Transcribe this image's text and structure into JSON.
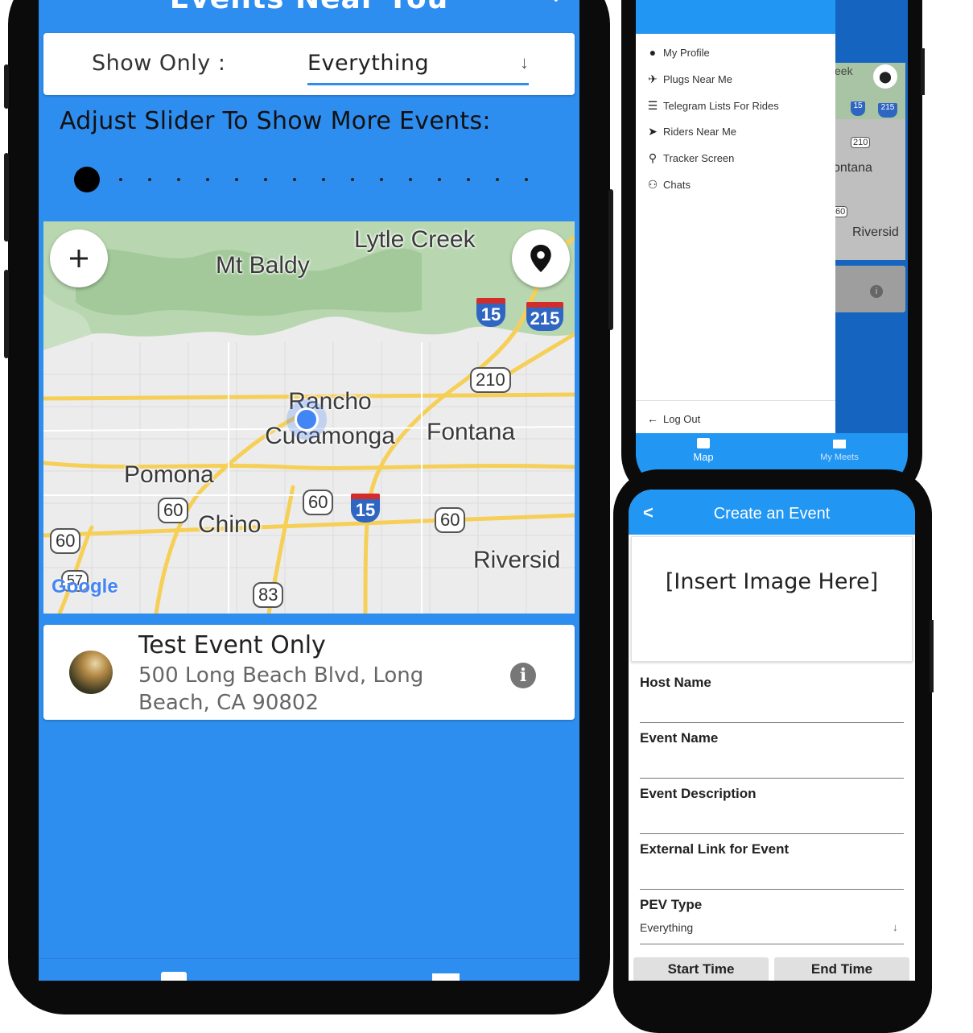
{
  "main_phone": {
    "header_title": "Events Near You",
    "filter": {
      "label": "Show Only :",
      "value": "Everything"
    },
    "slider": {
      "label": "Adjust Slider To Show More Events:",
      "value": 0
    },
    "map": {
      "places": [
        "Lytle Creek",
        "Mt Baldy",
        "Rancho Cucamonga",
        "Fontana",
        "Pomona",
        "Chino",
        "Riversid"
      ],
      "route_shields": [
        "15",
        "215",
        "210",
        "60",
        "60",
        "60",
        "15",
        "57",
        "83",
        "60"
      ],
      "attribution": "Google"
    },
    "event": {
      "title": "Test Event Only",
      "address": "500 Long Beach Blvd, Long Beach, CA 90802"
    }
  },
  "drawer_phone": {
    "menu": [
      {
        "label": "My Profile",
        "icon": "person-icon"
      },
      {
        "label": "Plugs Near Me",
        "icon": "airplane-icon"
      },
      {
        "label": "Telegram Lists For Rides",
        "icon": "list-icon"
      },
      {
        "label": "Riders Near Me",
        "icon": "navigation-icon"
      },
      {
        "label": "Tracker Screen",
        "icon": "run-icon"
      },
      {
        "label": "Chats",
        "icon": "people-icon"
      }
    ],
    "logout": "Log Out",
    "bg_map_labels": [
      "eek",
      "210",
      "ontana",
      "60",
      "Riversid"
    ],
    "bg_shields": [
      "15",
      "215"
    ],
    "nav": [
      {
        "label": "Map",
        "icon": "chat-icon",
        "active": true
      },
      {
        "label": "My Meets",
        "icon": "mail-icon",
        "active": false
      }
    ]
  },
  "create_phone": {
    "title": "Create an Event",
    "image_placeholder": "[Insert Image Here]",
    "fields": [
      "Host Name",
      "Event Name",
      "Event Description",
      "External Link for Event",
      "PEV Type"
    ],
    "pev_value": "Everything",
    "buttons": {
      "start": "Start Time",
      "end": "End Time"
    }
  },
  "colors": {
    "primary": "#2196f3",
    "screen_bg": "#2e8ef0",
    "accent_blue": "#4285f4"
  }
}
